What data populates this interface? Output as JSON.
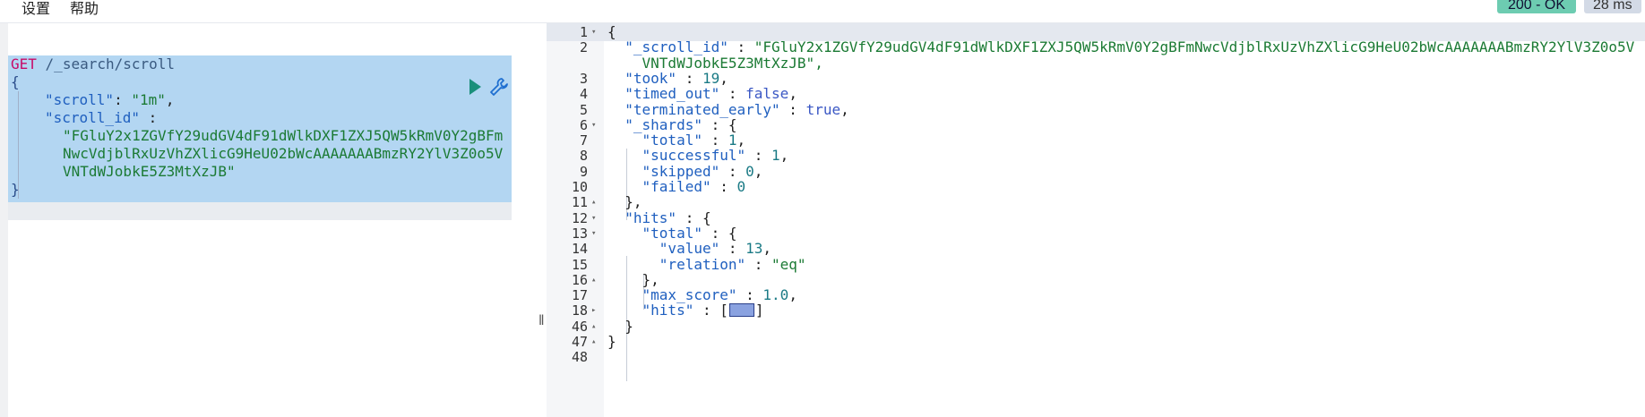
{
  "menu": {
    "settings": "设置",
    "help": "帮助"
  },
  "status": {
    "code": "200 - OK",
    "time": "28 ms"
  },
  "request": {
    "method": "GET",
    "path": "/_search/scroll",
    "open_brace": "{",
    "scroll_key": "\"scroll\"",
    "scroll_value": "\"1m\"",
    "scroll_id_key": "\"scroll_id\"",
    "scroll_id_lines": [
      "\"FGluY2x1ZGVfY29udGV4dF91dWlkDXF1ZXJ5QW5kRmV0Y2gBFm",
      "NwcVdjblRxUzVhZXlicG9HeU02bWcAAAAAAABmzRY2YlV3Z0o5V",
      "VNTdWJobkE5Z3MtXzJB\""
    ],
    "close_brace": "}"
  },
  "response": {
    "lines": [
      {
        "n": "1",
        "fold": "▾",
        "text": "{"
      },
      {
        "n": "2",
        "fold": "",
        "text": "  \"_scroll_id\" : \"FGluY2x1ZGVfY29udGV4dF91dWlkDXF1ZXJ5QW5kRmV0Y2gBFmNwcVdjblRxUzVhZXlicG9HeU02bWcAAAAAAABmzRY2YlV3Z0o5V"
      },
      {
        "n": "",
        "fold": "",
        "text": "    VNTdWJobkE5Z3MtXzJB\","
      },
      {
        "n": "3",
        "fold": "",
        "text": "  \"took\" : 19,"
      },
      {
        "n": "4",
        "fold": "",
        "text": "  \"timed_out\" : false,"
      },
      {
        "n": "5",
        "fold": "",
        "text": "  \"terminated_early\" : true,"
      },
      {
        "n": "6",
        "fold": "▾",
        "text": "  \"_shards\" : {"
      },
      {
        "n": "7",
        "fold": "",
        "text": "    \"total\" : 1,"
      },
      {
        "n": "8",
        "fold": "",
        "text": "    \"successful\" : 1,"
      },
      {
        "n": "9",
        "fold": "",
        "text": "    \"skipped\" : 0,"
      },
      {
        "n": "10",
        "fold": "",
        "text": "    \"failed\" : 0"
      },
      {
        "n": "11",
        "fold": "▴",
        "text": "  },"
      },
      {
        "n": "12",
        "fold": "▾",
        "text": "  \"hits\" : {"
      },
      {
        "n": "13",
        "fold": "▾",
        "text": "    \"total\" : {"
      },
      {
        "n": "14",
        "fold": "",
        "text": "      \"value\" : 13,"
      },
      {
        "n": "15",
        "fold": "",
        "text": "      \"relation\" : \"eq\""
      },
      {
        "n": "16",
        "fold": "▴",
        "text": "    },"
      },
      {
        "n": "17",
        "fold": "",
        "text": "    \"max_score\" : 1.0,"
      },
      {
        "n": "18",
        "fold": "▸",
        "text": "    \"hits\" : ["
      },
      {
        "n": "46",
        "fold": "▴",
        "text": "  }"
      },
      {
        "n": "47",
        "fold": "▴",
        "text": "}"
      },
      {
        "n": "48",
        "fold": "",
        "text": ""
      }
    ],
    "folded_tail": "]"
  },
  "colors": {
    "status_ok": "#6dccb1",
    "selection": "#b3d6f2",
    "method": "#c80a68",
    "string": "#1b7a34",
    "key": "#1f5fbf"
  }
}
